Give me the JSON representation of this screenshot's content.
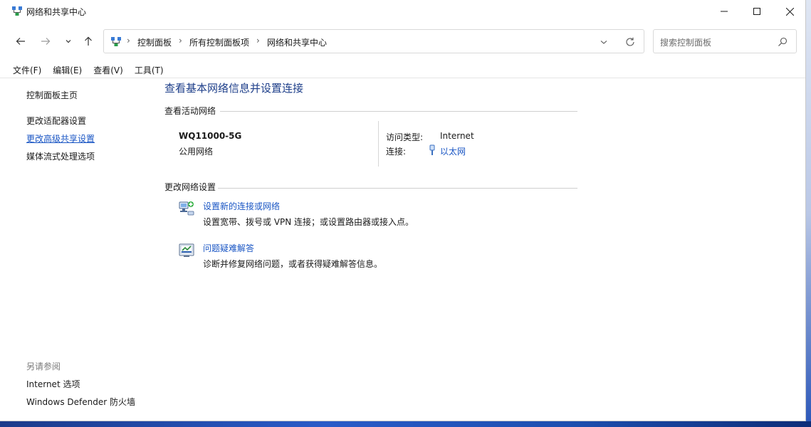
{
  "window": {
    "title": "网络和共享中心"
  },
  "address_bar": {
    "crumbs": [
      "控制面板",
      "所有控制面板项",
      "网络和共享中心"
    ],
    "separator": "›"
  },
  "search": {
    "placeholder": "搜索控制面板"
  },
  "menu": [
    "文件(F)",
    "编辑(E)",
    "查看(V)",
    "工具(T)"
  ],
  "left_pane": {
    "home": "控制面板主页",
    "links": [
      "更改适配器设置",
      "更改高级共享设置",
      "媒体流式处理选项"
    ],
    "active_link_index": 1,
    "see_also_header": "另请参阅",
    "see_also": [
      "Internet 选项",
      "Windows Defender 防火墙"
    ]
  },
  "main": {
    "title": "查看基本网络信息并设置连接",
    "active_networks_label": "查看活动网络",
    "network": {
      "name": "WQ11000-5G",
      "type": "公用网络",
      "access_type_label": "访问类型:",
      "access_type_value": "Internet",
      "connection_label": "连接:",
      "connection_value": "以太网"
    },
    "change_settings_label": "更改网络设置",
    "tasks": [
      {
        "icon": "network-setup-icon",
        "title": "设置新的连接或网络",
        "desc": "设置宽带、拨号或 VPN 连接；或设置路由器或接入点。"
      },
      {
        "icon": "troubleshoot-icon",
        "title": "问题疑难解答",
        "desc": "诊断并修复网络问题，或者获得疑难解答信息。"
      }
    ]
  },
  "colors": {
    "link": "#1a56c4",
    "title": "#1e3f8a",
    "muted": "#7a7a7a"
  }
}
